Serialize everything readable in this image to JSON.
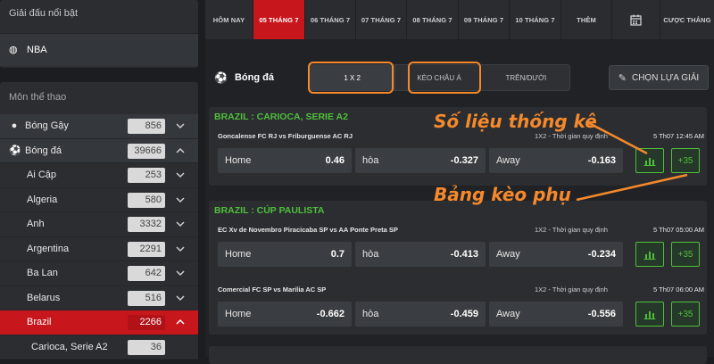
{
  "sidebar": {
    "featured": {
      "title": "Giải đấu nổi bật",
      "items": [
        {
          "label": "NBA",
          "icon": "basketball-icon"
        }
      ]
    },
    "sports": {
      "title": "Môn thể thao",
      "items": [
        {
          "label": "Bóng Gậy",
          "count": "856",
          "icon": "baseball-icon",
          "level": "top",
          "expanded": false
        },
        {
          "label": "Bóng đá",
          "count": "39666",
          "icon": "soccer-icon",
          "level": "top",
          "expanded": true
        },
        {
          "label": "Ai Cập",
          "count": "253",
          "level": "sub",
          "expanded": false
        },
        {
          "label": "Algeria",
          "count": "580",
          "level": "sub",
          "expanded": false
        },
        {
          "label": "Anh",
          "count": "3332",
          "level": "sub",
          "expanded": false
        },
        {
          "label": "Argentina",
          "count": "2291",
          "level": "sub",
          "expanded": false
        },
        {
          "label": "Ba Lan",
          "count": "642",
          "level": "sub",
          "expanded": false
        },
        {
          "label": "Belarus",
          "count": "516",
          "level": "sub",
          "expanded": false
        },
        {
          "label": "Brazil",
          "count": "2266",
          "level": "sub",
          "expanded": true,
          "active": true
        },
        {
          "label": "Carioca, Serie A2",
          "count": "36",
          "level": "subsub"
        }
      ]
    }
  },
  "datebar": {
    "tabs": [
      "HÔM NAY",
      "05 THÁNG 7",
      "06 THÁNG 7",
      "07 THÁNG 7",
      "08 THÁNG 7",
      "09 THÁNG 7",
      "10 THÁNG 7",
      "THÊM",
      "",
      "CƯỢC THẮNG"
    ],
    "active_index": 1
  },
  "toolbar": {
    "sport": "Bóng đá",
    "market_tabs": [
      "1 X 2",
      "KÈO CHÂU Á",
      "TRÊN/DƯỚI"
    ],
    "active_market": 0,
    "choose_button": "CHỌN LỰA GIẢI"
  },
  "leagues": [
    {
      "name": "BRAZIL : CARIOCA, SERIE A2",
      "matches": [
        {
          "teams": "Goncalense FC RJ vs Friburguense AC RJ",
          "type": "1X2 - Thời gian quy định",
          "time": "5 Th07 12:45 AM",
          "odds": [
            {
              "name": "Home",
              "value": "0.46"
            },
            {
              "name": "hòa",
              "value": "-0.327"
            },
            {
              "name": "Away",
              "value": "-0.163"
            }
          ],
          "more": "+35"
        }
      ]
    },
    {
      "name": "BRAZIL : CÚP PAULISTA",
      "matches": [
        {
          "teams": "EC Xv de Novembro Piracicaba SP vs AA Ponte Preta SP",
          "type": "1X2 - Thời gian quy định",
          "time": "5 Th07 05:00 AM",
          "odds": [
            {
              "name": "Home",
              "value": "0.7"
            },
            {
              "name": "hòa",
              "value": "-0.413"
            },
            {
              "name": "Away",
              "value": "-0.234"
            }
          ],
          "more": "+35"
        },
        {
          "teams": "Comercial FC SP vs Marilia AC SP",
          "type": "1X2 - Thời gian quy định",
          "time": "5 Th07 06:00 AM",
          "odds": [
            {
              "name": "Home",
              "value": "-0.662"
            },
            {
              "name": "hòa",
              "value": "-0.459"
            },
            {
              "name": "Away",
              "value": "-0.556"
            }
          ],
          "more": "+35"
        }
      ]
    }
  ],
  "annotations": {
    "stats": "Số liệu thống kê",
    "side_odds": "Bảng kèo phụ"
  },
  "colors": {
    "accent_red": "#c8161d",
    "league_green": "#4fbf3a",
    "highlight_orange": "#f5892b"
  }
}
